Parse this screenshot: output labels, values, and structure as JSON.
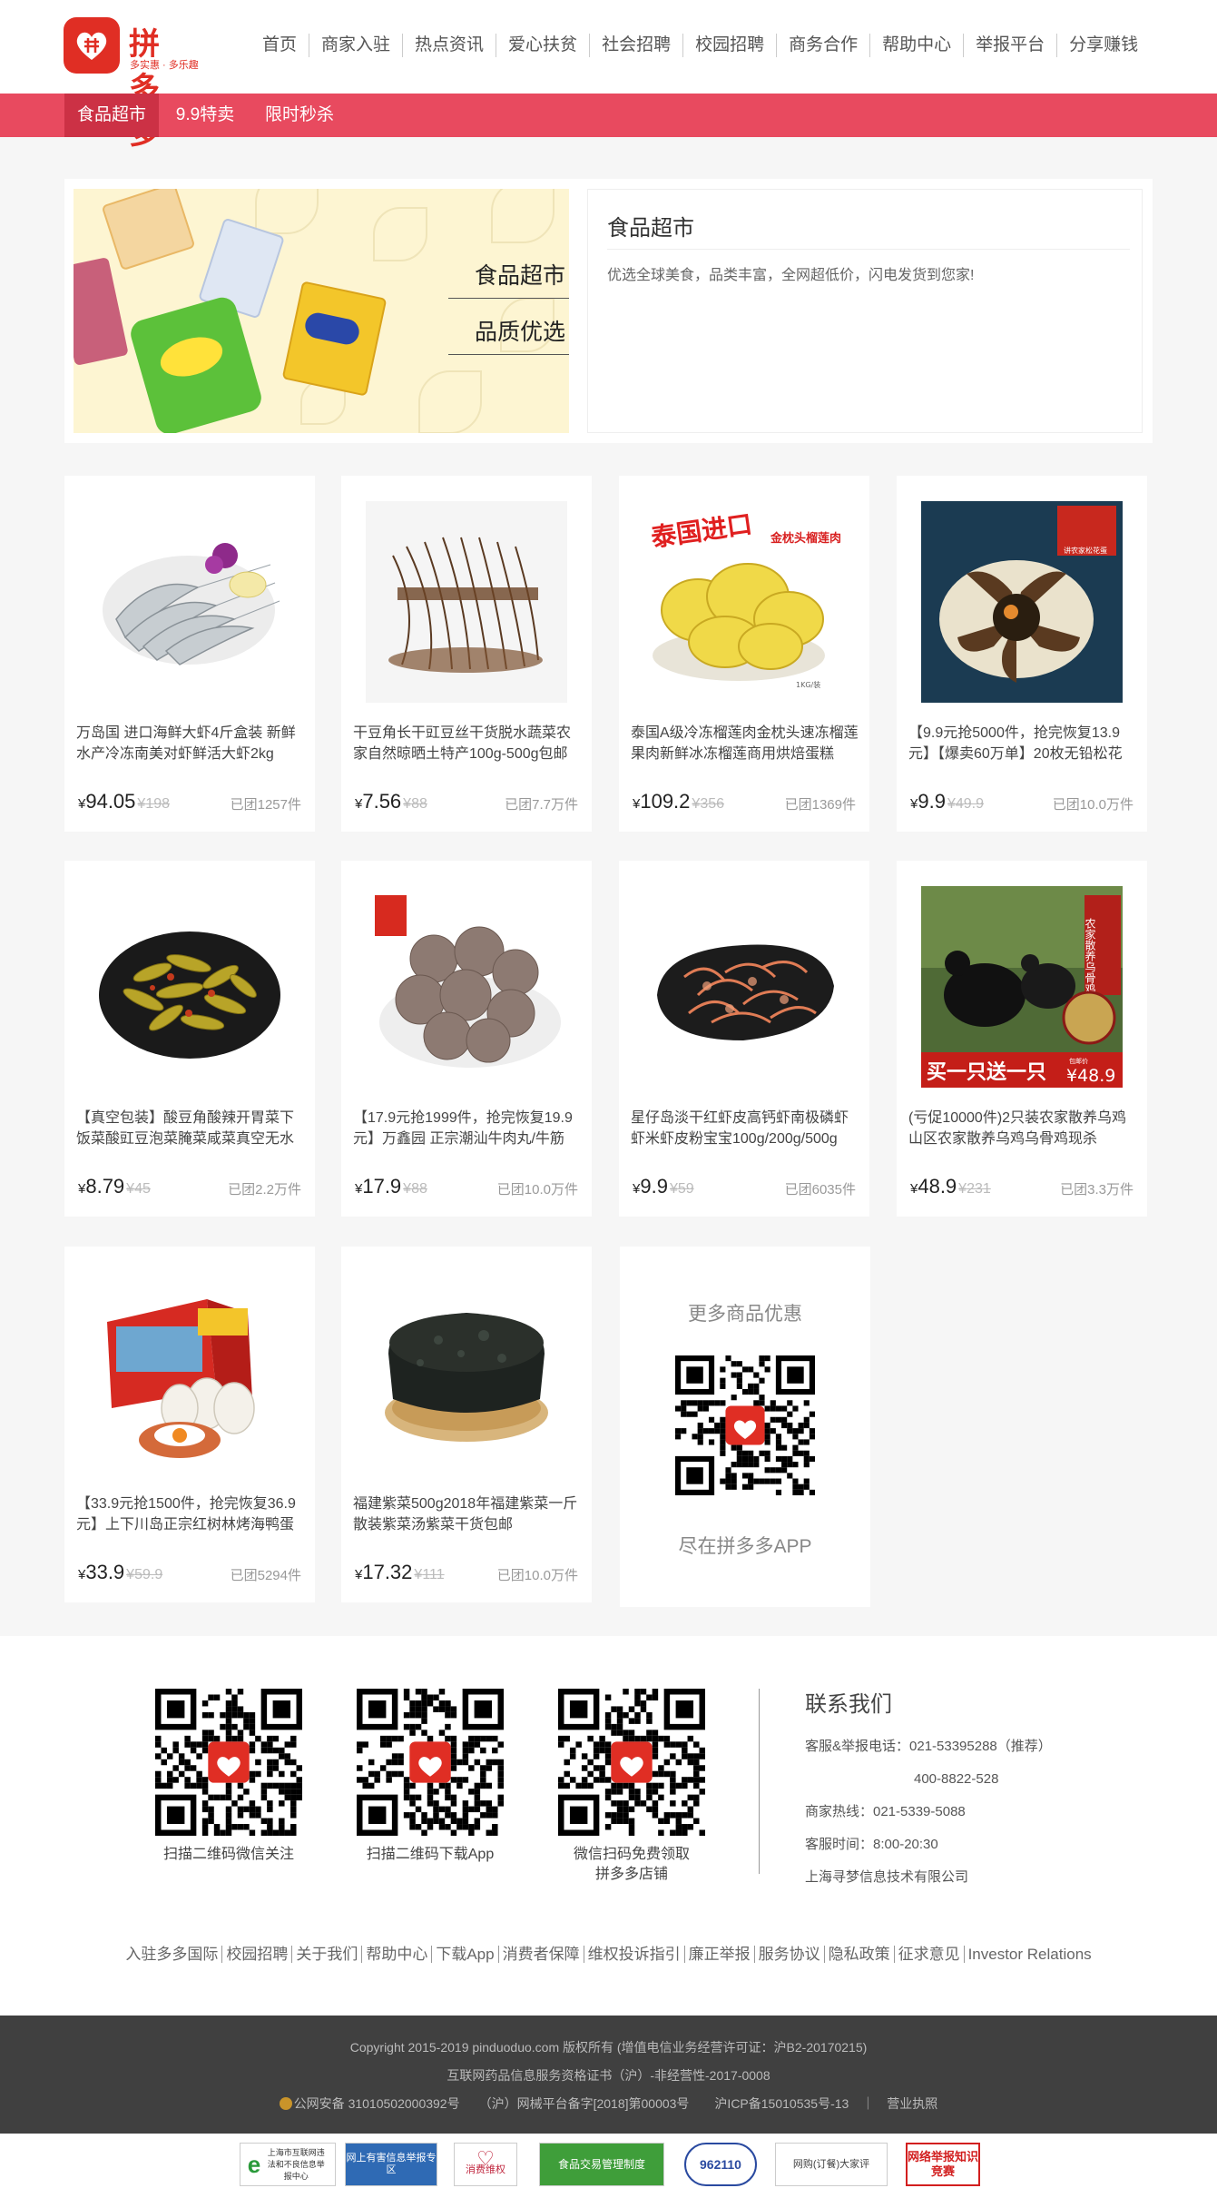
{
  "brand": {
    "name": "拼多多",
    "slogan": "多实惠 · 多乐趣"
  },
  "topnav": [
    "首页",
    "商家入驻",
    "热点资讯",
    "爱心扶贫",
    "社会招聘",
    "校园招聘",
    "商务合作",
    "帮助中心",
    "举报平台",
    "分享赚钱"
  ],
  "subtabs": [
    "食品超市",
    "9.9特卖",
    "限时秒杀"
  ],
  "banner": {
    "img_title": "食品超市",
    "img_subtitle": "品质优选",
    "title": "食品超市",
    "desc": "优选全球美食，品类丰富，全网超低价，闪电发货到您家!"
  },
  "products": [
    {
      "title": "万岛国 进口海鲜大虾4斤盒装 新鲜水产冷冻南美对虾鲜活大虾2kg",
      "price": "94.05",
      "orig": "198",
      "sold": "已团1257件"
    },
    {
      "title": "干豆角长干豇豆丝干货脱水蔬菜农家自然晾晒土特产100g-500g包邮",
      "price": "7.56",
      "orig": "88",
      "sold": "已团7.7万件"
    },
    {
      "title": "泰国A级冷冻榴莲肉金枕头速冻榴莲果肉新鲜冰冻榴莲商用烘焙蛋糕",
      "price": "109.2",
      "orig": "356",
      "sold": "已团1369件"
    },
    {
      "title": "【9.9元抢5000件，抢完恢复13.9元】【爆卖60万单】20枚无铅松花",
      "price": "9.9",
      "orig": "49.9",
      "sold": "已团10.0万件"
    },
    {
      "title": "【真空包装】酸豆角酸辣开胃菜下饭菜酸豇豆泡菜腌菜咸菜真空无水",
      "price": "8.79",
      "orig": "45",
      "sold": "已团2.2万件"
    },
    {
      "title": "【17.9元抢1999件，抢完恢复19.9元】万鑫园 正宗潮汕牛肉丸/牛筋",
      "price": "17.9",
      "orig": "88",
      "sold": "已团10.0万件"
    },
    {
      "title": "星仔岛淡干红虾皮高钙虾南极磷虾虾米虾皮粉宝宝100g/200g/500g",
      "price": "9.9",
      "orig": "59",
      "sold": "已团6035件"
    },
    {
      "title": "(亏促10000件)2只装农家散养乌鸡山区农家散养乌鸡乌骨鸡现杀",
      "price": "48.9",
      "orig": "231",
      "sold": "已团3.3万件"
    },
    {
      "title": "【33.9元抢1500件，抢完恢复36.9元】上下川岛正宗红树林烤海鸭蛋",
      "price": "33.9",
      "orig": "59.9",
      "sold": "已团5294件"
    },
    {
      "title": "福建紫菜500g2018年福建紫菜一斤散装紫菜汤紫菜干货包邮",
      "price": "17.32",
      "orig": "111",
      "sold": "已团10.0万件"
    }
  ],
  "currency": "¥",
  "image_texts": {
    "durian_import": "泰国进口",
    "durian_label": "金枕头榴莲肉",
    "durian_weight": "1KG/装",
    "egg_box": "讲农家松花蛋",
    "chicken_promo": "买一只送一只",
    "chicken_price": "¥48.9",
    "chicken_side": "农家散养乌骨鸡",
    "chicken_small": "包邮价"
  },
  "promo": {
    "title": "更多商品优惠",
    "bottom": "尽在拼多多APP"
  },
  "footer": {
    "qr_captions": [
      "扫描二维码微信关注",
      "扫描二维码下载App",
      "微信扫码免费领取",
      "拼多多店铺"
    ],
    "contact_title": "联系我们",
    "contact_lines": [
      "客服&举报电话：021-53395288（推荐）",
      "400-8822-528",
      "商家热线：021-5339-5088",
      "客服时间：8:00-20:30",
      "上海寻梦信息技术有限公司"
    ],
    "links": [
      "入驻多多国际",
      "校园招聘",
      "关于我们",
      "帮助中心",
      "下载App",
      "消费者保障",
      "维权投诉指引",
      "廉正举报",
      "服务协议",
      "隐私政策",
      "征求意见",
      "Investor Relations"
    ],
    "copyright": "Copyright 2015-2019 pinduoduo.com 版权所有 (增值电信业务经营许可证：沪B2-20170215)",
    "license": "互联网药品信息服务资格证书（沪）-非经营性-2017-0008",
    "records": "公网安备 31010502000392号　　（沪）网械平台备字[2018]第00003号　　沪ICP备15010535号-13　｜　营业执照",
    "badges": [
      "上海市互联网违法和不良信息举报中心",
      "网上有害信息举报专区",
      "消费维权",
      "食品交易管理制度",
      "962110",
      "网购(订餐)大家评",
      "网络举报知识竞赛"
    ]
  },
  "colors": {
    "brand": "#e02e24",
    "subbar": "#e84a5f",
    "subbar_active": "#cc3145",
    "footer_dark": "#404040"
  }
}
